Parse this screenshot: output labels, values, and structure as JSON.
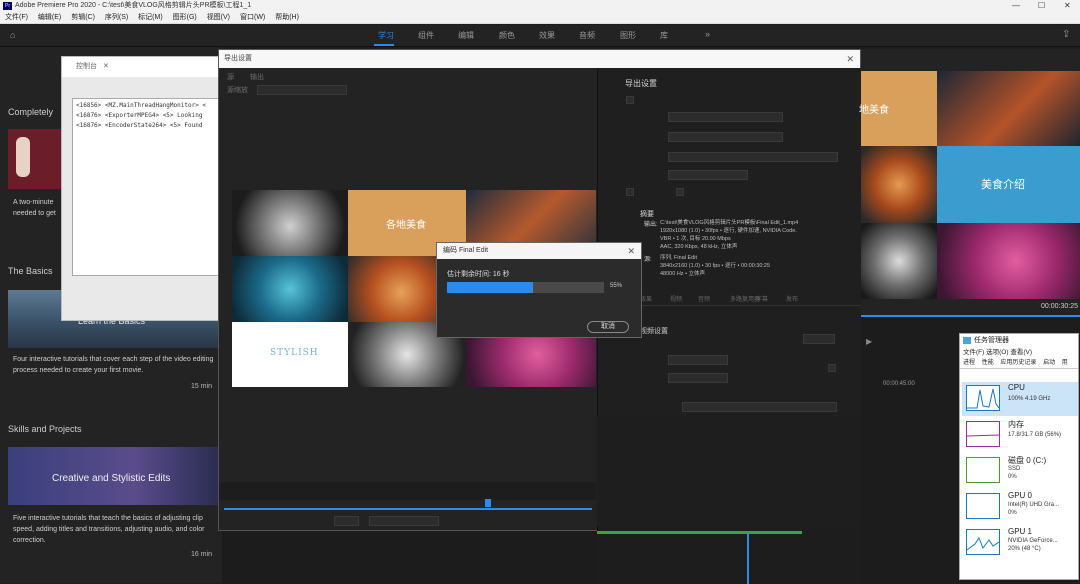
{
  "window": {
    "title": "Adobe Premiere Pro 2020 - C:\\test\\美食VLOG风格剪辑片头PR模板\\工程1_1"
  },
  "menu": [
    "文件(F)",
    "编辑(E)",
    "剪辑(C)",
    "序列(S)",
    "标记(M)",
    "图形(G)",
    "视图(V)",
    "窗口(W)",
    "帮助(H)"
  ],
  "workspaces": [
    "学习",
    "组件",
    "编辑",
    "颜色",
    "效果",
    "音频",
    "图形",
    "库"
  ],
  "active_workspace": "学习",
  "learn": {
    "completely_title": "Completely",
    "intro_desc": "A two-minute\nneeded to get",
    "basics_heading": "The Basics",
    "basics_thumb_text": "Learn the Basics",
    "basics_desc": "Four interactive tutorials that cover each step of the video editing process needed to create your first movie.",
    "basics_min": "15 min",
    "skills_heading": "Skills and Projects",
    "skills_thumb_text": "Creative and Stylistic Edits",
    "skills_desc": "Five interactive tutorials that teach the basics of adjusting clip speed, adding titles and transitions, adjusting audio, and color correction.",
    "skills_min": "16 min"
  },
  "console": {
    "title": "控制台",
    "lines": "<16856> <MZ.MainThreadHangMonitor> <\n<16876> <ExporterMPEG4> <5> Looking\n<16876> <EncoderState264> <5> Found"
  },
  "export_dialog": {
    "title": "导出设置",
    "source_tab": "源",
    "output_tab": "输出",
    "source_scaling": "源缩放",
    "export_settings_heading": "导出设置",
    "summary_heading": "摘要",
    "summary_output_label": "输出:",
    "summary_output": "C:\\test\\美食VLOG风格剪辑片头PR模板\\Final Edit_1.mp4\n1920x1080 (1.0) • 30fps • 逐行, 硬件加速, NVIDIA Code.\nVBR • 1 次, 目标 20.00 Mbps\nAAC, 320 Kbps, 48 kHz, 立体声",
    "summary_source_label": "源:",
    "summary_source": "序列, Final Edit\n3840x2160 (1.0) • 30 fps • 逐行 • 00:00:30:25\n48000 Hz • 立体声",
    "video_settings": "视频设置",
    "bottom_tabs": [
      "效果",
      "视频",
      "音频",
      "多路复用器",
      "字幕",
      "发布"
    ],
    "cancel_left": "取消"
  },
  "preview": {
    "tile_local_food": "各地美食",
    "tile_stylish": "STYLISH"
  },
  "progress": {
    "title": "编码 Final Edit",
    "remaining": "估计剩余时间: 16 秒",
    "percent_text": "55%",
    "fraction": 0.55,
    "cancel": "取消"
  },
  "program": {
    "tile_food": "地美食",
    "tile_intro": "美食介绍",
    "timecode": "00:00:30:25",
    "timeline_time": "00:00:45:00"
  },
  "task_manager": {
    "title": "任务管理器",
    "menu": [
      "文件(F)",
      "选项(O)",
      "查看(V)"
    ],
    "tabs": [
      "进程",
      "性能",
      "应用历史记录",
      "启动",
      "用"
    ],
    "rows": [
      {
        "name": "CPU",
        "sub1": "100% 4.19 GHz",
        "sub2": ""
      },
      {
        "name": "内存",
        "sub1": "17.8/31.7 GB (56%)",
        "sub2": ""
      },
      {
        "name": "磁盘 0 (C:)",
        "sub1": "SSD",
        "sub2": "0%"
      },
      {
        "name": "GPU 0",
        "sub1": "Intel(R) UHD Gra...",
        "sub2": "0%"
      },
      {
        "name": "GPU 1",
        "sub1": "NVIDIA GeForce...",
        "sub2": "20% (48 °C)"
      }
    ]
  },
  "colors": {
    "accent": "#2d8ceb",
    "food_orange": "#d9a05b",
    "intro_blue": "#3b9cd0",
    "magenta": "#b0317a",
    "cpu_line": "#1779c4",
    "mem_line": "#9b2a9f",
    "disk_line": "#4c9a2a"
  }
}
